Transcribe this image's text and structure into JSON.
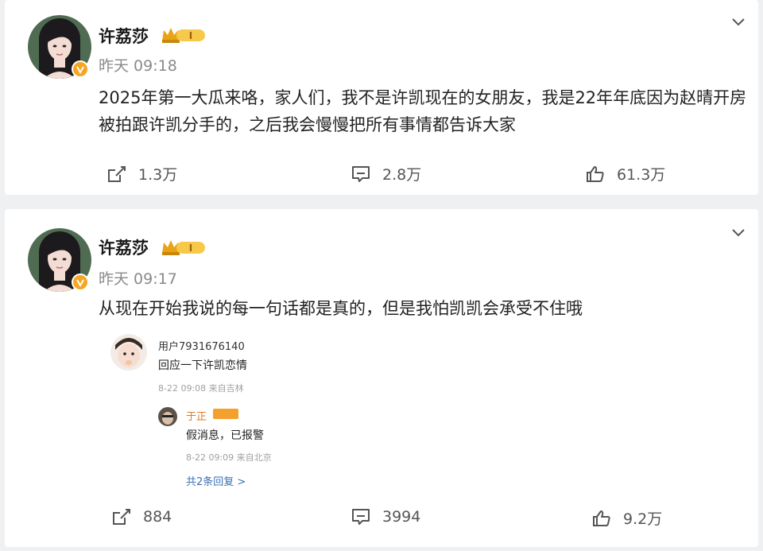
{
  "colors": {
    "page_bg": "#eff0f2",
    "card_bg": "#ffffff",
    "accent_orange": "#f5a623",
    "link_blue": "#3b6fb6",
    "muted": "#8a8a8a"
  },
  "posts": [
    {
      "username": "许荔莎",
      "badge": "crown-level-icon",
      "time": "昨天 09:18",
      "text": "2025年第一大瓜来咯，家人们，我不是许凯现在的女朋友，我是22年年底因为赵晴开房被拍跟许凯分手的，之后我会慢慢把所有事情都告诉大家",
      "shares": "1.3万",
      "comments": "2.8万",
      "likes": "61.3万"
    },
    {
      "username": "许荔莎",
      "badge": "crown-level-icon",
      "time": "昨天 09:17",
      "text": "从现在开始我说的每一句话都是真的，但是我怕凯凯会承受不住哦",
      "comment_thread": {
        "user": "用户7931676140",
        "text": "回应一下许凯恋情",
        "meta": "8-22 09:08 来自吉林",
        "reply_user": "于正",
        "reply_text": "假消息，已报警",
        "reply_meta": "8-22 09:09 来自北京",
        "more": "共2条回复 >"
      },
      "shares": "884",
      "comments": "3994",
      "likes": "9.2万"
    }
  ]
}
